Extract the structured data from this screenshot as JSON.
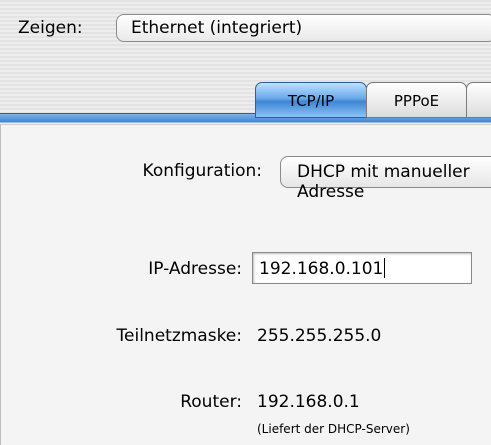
{
  "show": {
    "label": "Zeigen:",
    "value": "Ethernet (integriert)"
  },
  "tabs": [
    {
      "label": "TCP/IP",
      "active": true
    },
    {
      "label": "PPPoE",
      "active": false
    }
  ],
  "form": {
    "config_label": "Konfiguration:",
    "config_value": "DHCP mit manueller Adresse",
    "ip_label": "IP-Adresse:",
    "ip_value": "192.168.0.101",
    "mask_label": "Teilnetzmaske:",
    "mask_value": "255.255.255.0",
    "router_label": "Router:",
    "router_value": "192.168.0.1",
    "router_note": "(Liefert der DHCP-Server)"
  }
}
